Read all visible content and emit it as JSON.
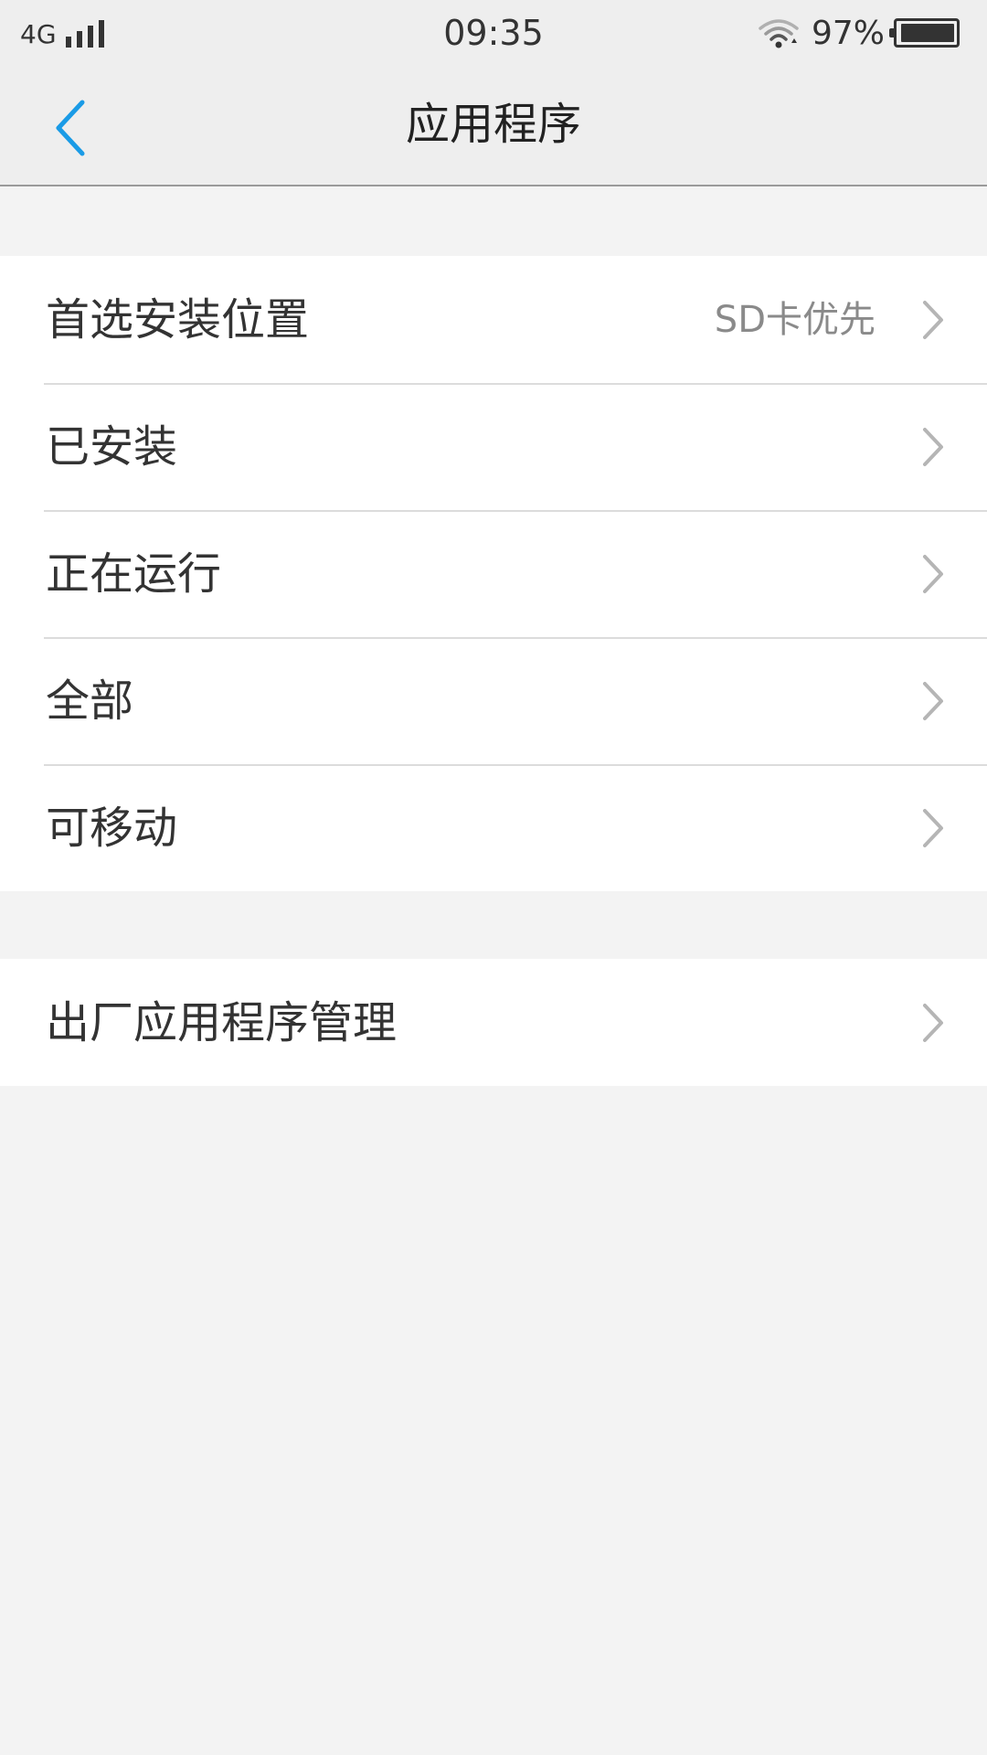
{
  "status_bar": {
    "network": "4G",
    "time": "09:35",
    "battery": "97%",
    "battery_level": 0.97
  },
  "header": {
    "title": "应用程序",
    "back_icon": "chevron-left-icon"
  },
  "groups": [
    {
      "rows": [
        {
          "label": "首选安装位置",
          "value": "SD卡优先"
        },
        {
          "label": "已安装",
          "value": ""
        },
        {
          "label": "正在运行",
          "value": ""
        },
        {
          "label": "全部",
          "value": ""
        },
        {
          "label": "可移动",
          "value": ""
        }
      ]
    },
    {
      "rows": [
        {
          "label": "出厂应用程序管理",
          "value": ""
        }
      ]
    }
  ],
  "colors": {
    "accent": "#1a9be6",
    "background": "#f3f3f3",
    "row_background": "#ffffff",
    "chevron": "#b5b5b5"
  }
}
